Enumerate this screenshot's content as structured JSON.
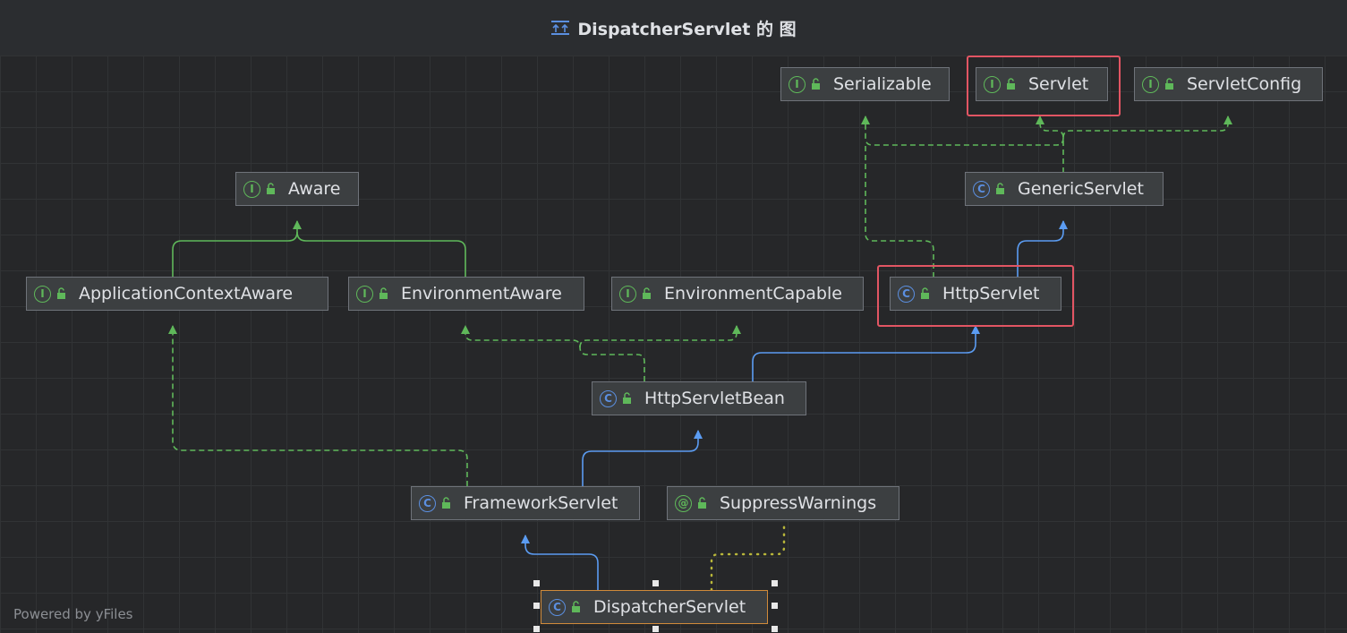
{
  "title": {
    "text": "DispatcherServlet 的 图",
    "icon": "class-diagram-icon"
  },
  "footer": {
    "text": "Powered by yFiles"
  },
  "colors": {
    "interface": "#5fb85a",
    "class": "#5b8fe0",
    "implements_edge": "#5fb85a",
    "extends_edge": "#5b9cf2",
    "annotation_edge": "#b8b63a",
    "highlight": "#e25563",
    "selection": "#d08a3a"
  },
  "nodes": [
    {
      "id": "serializable",
      "label": "Serializable",
      "kind": "interface"
    },
    {
      "id": "servlet",
      "label": "Servlet",
      "kind": "interface",
      "highlighted": true
    },
    {
      "id": "servlet-config",
      "label": "ServletConfig",
      "kind": "interface"
    },
    {
      "id": "aware",
      "label": "Aware",
      "kind": "interface"
    },
    {
      "id": "generic-servlet",
      "label": "GenericServlet",
      "kind": "class"
    },
    {
      "id": "application-context-aware",
      "label": "ApplicationContextAware",
      "kind": "interface"
    },
    {
      "id": "environment-aware",
      "label": "EnvironmentAware",
      "kind": "interface"
    },
    {
      "id": "environment-capable",
      "label": "EnvironmentCapable",
      "kind": "interface"
    },
    {
      "id": "http-servlet",
      "label": "HttpServlet",
      "kind": "class",
      "highlighted": true
    },
    {
      "id": "http-servlet-bean",
      "label": "HttpServletBean",
      "kind": "class"
    },
    {
      "id": "framework-servlet",
      "label": "FrameworkServlet",
      "kind": "class"
    },
    {
      "id": "suppress-warnings",
      "label": "SuppressWarnings",
      "kind": "annotation"
    },
    {
      "id": "dispatcher-servlet",
      "label": "DispatcherServlet",
      "kind": "class",
      "selected": true
    }
  ],
  "edges": [
    {
      "from": "generic-servlet",
      "to": "servlet",
      "type": "implements"
    },
    {
      "from": "generic-servlet",
      "to": "servlet-config",
      "type": "implements"
    },
    {
      "from": "generic-servlet",
      "to": "serializable",
      "type": "implements"
    },
    {
      "from": "http-servlet",
      "to": "serializable",
      "type": "implements"
    },
    {
      "from": "http-servlet",
      "to": "generic-servlet",
      "type": "extends"
    },
    {
      "from": "application-context-aware",
      "to": "aware",
      "type": "extends-interface"
    },
    {
      "from": "environment-aware",
      "to": "aware",
      "type": "extends-interface"
    },
    {
      "from": "http-servlet-bean",
      "to": "environment-aware",
      "type": "implements"
    },
    {
      "from": "http-servlet-bean",
      "to": "environment-capable",
      "type": "implements"
    },
    {
      "from": "http-servlet-bean",
      "to": "http-servlet",
      "type": "extends"
    },
    {
      "from": "framework-servlet",
      "to": "application-context-aware",
      "type": "implements"
    },
    {
      "from": "framework-servlet",
      "to": "http-servlet-bean",
      "type": "extends"
    },
    {
      "from": "dispatcher-servlet",
      "to": "framework-servlet",
      "type": "extends"
    },
    {
      "from": "dispatcher-servlet",
      "to": "suppress-warnings",
      "type": "annotated"
    }
  ]
}
